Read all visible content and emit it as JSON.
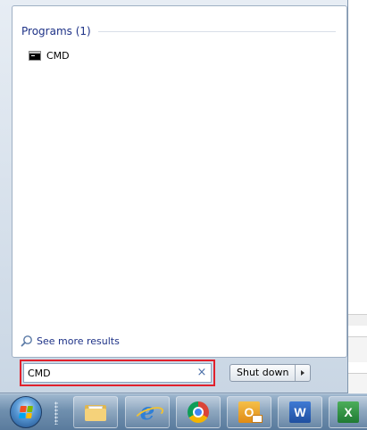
{
  "search_results": {
    "group_title": "Programs (1)",
    "items": [
      {
        "label": "CMD",
        "icon": "cmd-icon"
      }
    ],
    "see_more_label": "See more results"
  },
  "search": {
    "value": "CMD",
    "clear_symbol": "×"
  },
  "shutdown": {
    "label": "Shut down",
    "arrow_icon": "triangle-right-icon"
  },
  "taskbar": {
    "start_button_icon": "windows-orb-icon",
    "pinned": [
      {
        "name": "Windows Explorer",
        "icon": "folder-icon"
      },
      {
        "name": "Internet Explorer",
        "icon": "internet-explorer-icon"
      },
      {
        "name": "Google Chrome",
        "icon": "chrome-icon"
      },
      {
        "name": "Outlook",
        "icon": "outlook-icon",
        "glyph": "O"
      },
      {
        "name": "Word",
        "icon": "word-icon",
        "glyph": "W"
      },
      {
        "name": "Excel",
        "icon": "excel-icon",
        "glyph": "X"
      }
    ]
  },
  "colors": {
    "highlight_border": "#e1212c",
    "header_text": "#1e3287",
    "link_text": "#1e3287"
  }
}
